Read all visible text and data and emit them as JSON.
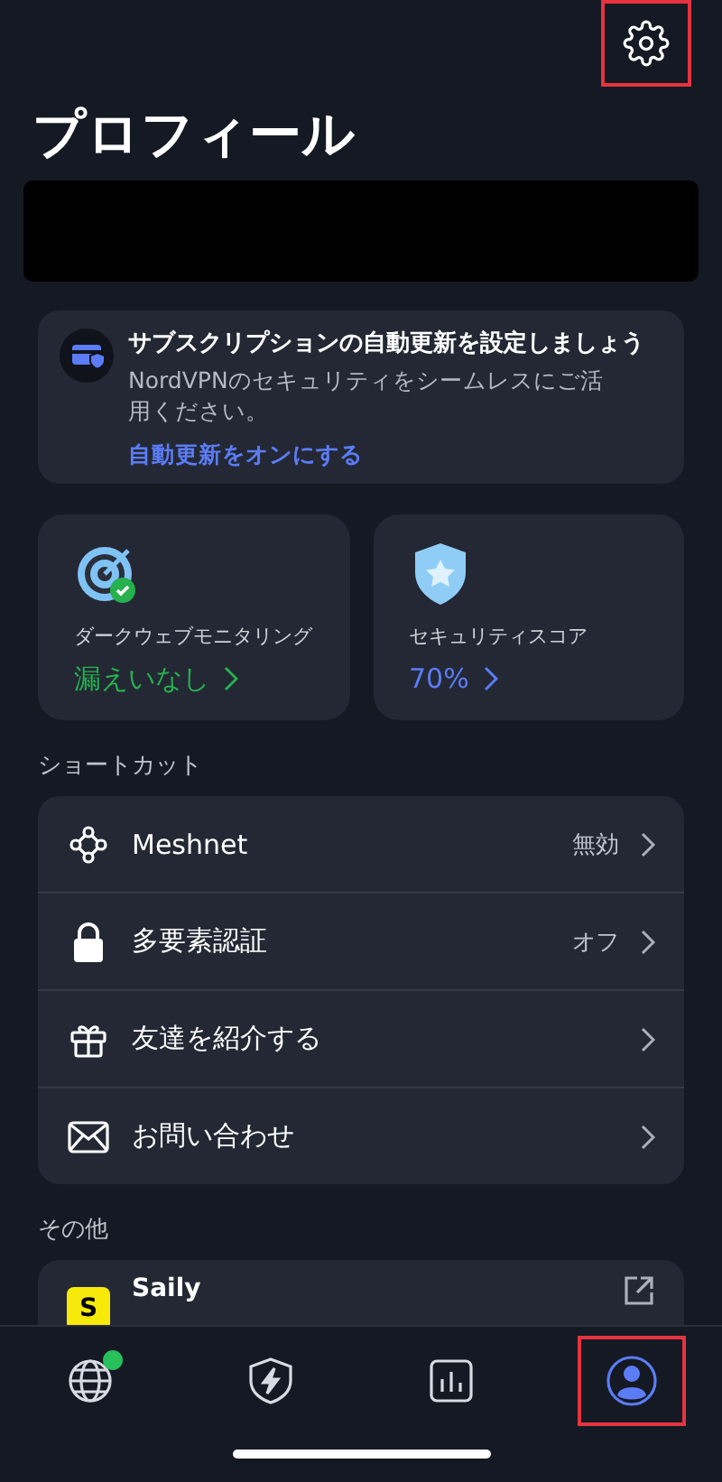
{
  "header": {
    "settings_highlighted": true,
    "title": "プロフィール"
  },
  "account": {
    "redacted": true
  },
  "banner": {
    "title": "サブスクリプションの自動更新を設定しましょう",
    "text": "NordVPNのセキュリティをシームレスにご活用ください。",
    "link": "自動更新をオンにする"
  },
  "tiles": [
    {
      "kind": "monitor",
      "label": "ダークウェブモニタリング",
      "value": "漏えいなし",
      "color": "#27b04e"
    },
    {
      "kind": "score",
      "label": "セキュリティスコア",
      "value": "70%",
      "color": "#5b7cf6"
    }
  ],
  "shortcuts": {
    "heading": "ショートカット",
    "items": [
      {
        "kind": "mesh",
        "label": "Meshnet",
        "status": "無効"
      },
      {
        "kind": "lock",
        "label": "多要素認証",
        "status": "オフ"
      },
      {
        "kind": "gift",
        "label": "友達を紹介する"
      },
      {
        "kind": "mail",
        "label": "お問い合わせ"
      }
    ]
  },
  "other": {
    "heading": "その他",
    "items": [
      {
        "label": "Saily",
        "logo_letter": "S"
      }
    ]
  },
  "nav": [
    {
      "kind": "globe",
      "selected": false,
      "badge": true,
      "highlighted": false
    },
    {
      "kind": "shield",
      "selected": false,
      "badge": false,
      "highlighted": false
    },
    {
      "kind": "stats",
      "selected": false,
      "badge": false,
      "highlighted": false
    },
    {
      "kind": "profile",
      "selected": true,
      "badge": false,
      "highlighted": true
    }
  ]
}
